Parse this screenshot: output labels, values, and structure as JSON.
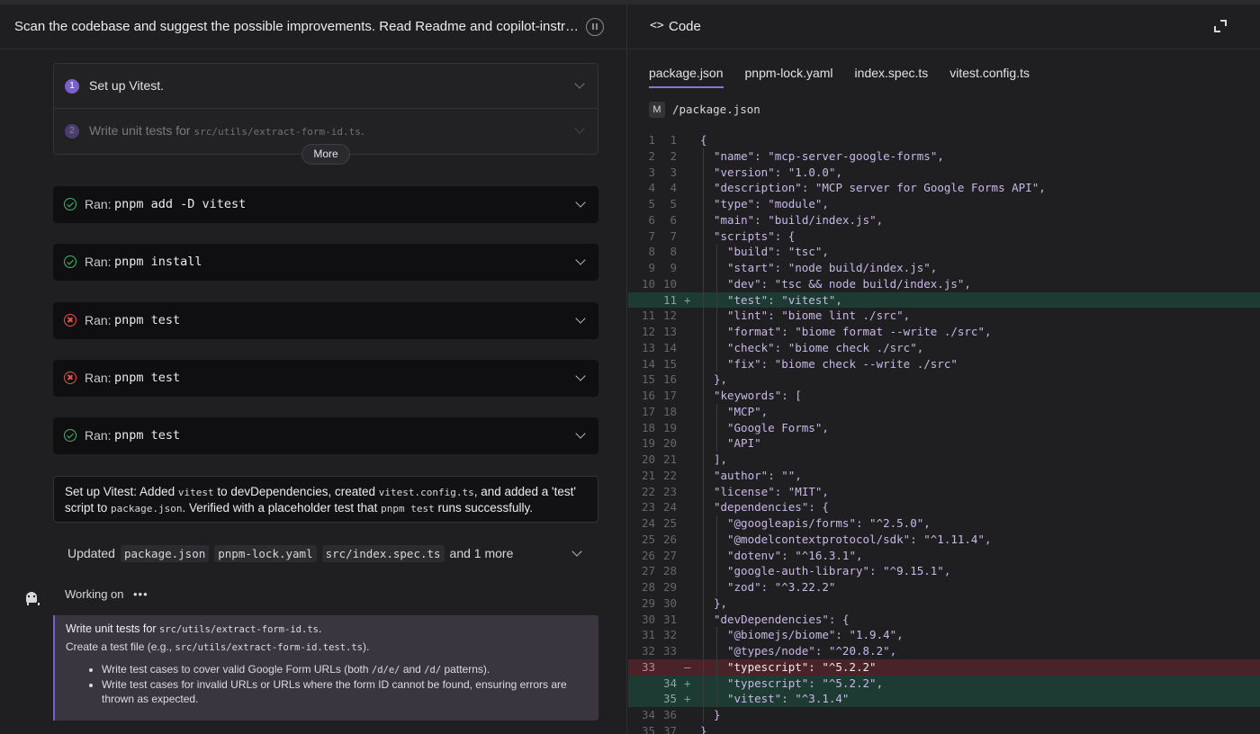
{
  "task": {
    "title": "Scan the codebase and suggest the possible improvements. Read Readme and copilot-instructions.md",
    "pause_icon": "pause-icon"
  },
  "plan": {
    "steps": [
      {
        "number": "1",
        "label": "Set up Vitest.",
        "code": ""
      },
      {
        "number": "2",
        "label": "Write unit tests for ",
        "code": "src/utils/extract-form-id.ts",
        "suffix": "."
      }
    ],
    "more_label": "More"
  },
  "runs": [
    {
      "status": "success",
      "label": "Ran:",
      "command": "pnpm add -D vitest"
    },
    {
      "status": "success",
      "label": "Ran:",
      "command": "pnpm install"
    },
    {
      "status": "error",
      "label": "Ran:",
      "command": "pnpm test"
    },
    {
      "status": "error",
      "label": "Ran:",
      "command": "pnpm test"
    },
    {
      "status": "success",
      "label": "Ran:",
      "command": "pnpm test"
    }
  ],
  "summary": {
    "t1": "Set up Vitest: Added ",
    "c1": "vitest",
    "t2": " to devDependencies, created ",
    "c2": "vitest.config.ts",
    "t3": ", and added a 'test' script to ",
    "c3": "package.json",
    "t4": ". Verified with a placeholder test that ",
    "c4": "pnpm test",
    "t5": " runs successfully."
  },
  "updated": {
    "label": "Updated",
    "files": [
      "package.json",
      "pnpm-lock.yaml",
      "src/index.spec.ts"
    ],
    "more": "and 1 more"
  },
  "working": {
    "label": "Working on",
    "dots": "•••",
    "title_text": "Write unit tests for ",
    "title_code": "src/utils/extract-form-id.ts",
    "title_suffix": ".",
    "desc_text": "Create a test file (e.g., ",
    "desc_code": "src/utils/extract-form-id.test.ts",
    "desc_suffix": ").",
    "b1_a": "Write test cases to cover valid Google Form URLs (both ",
    "b1_c1": "/d/e/",
    "b1_b": " and ",
    "b1_c2": "/d/",
    "b1_c": " patterns).",
    "b2": "Write test cases for invalid URLs or URLs where the form ID cannot be found, ensuring errors are thrown as expected."
  },
  "code_panel": {
    "title": "Code",
    "icon": "code-brackets-icon",
    "tabs": [
      "package.json",
      "pnpm-lock.yaml",
      "index.spec.ts",
      "vitest.config.ts"
    ],
    "active_tab": 0,
    "file_badge": "M",
    "file_path": "/package.json",
    "diff_lines": [
      {
        "old": "1",
        "new": "1",
        "type": "ctx",
        "indent": 0,
        "text": "{"
      },
      {
        "old": "2",
        "new": "2",
        "type": "ctx",
        "indent": 1,
        "text": "\"name\": \"mcp-server-google-forms\","
      },
      {
        "old": "3",
        "new": "3",
        "type": "ctx",
        "indent": 1,
        "text": "\"version\": \"1.0.0\","
      },
      {
        "old": "4",
        "new": "4",
        "type": "ctx",
        "indent": 1,
        "text": "\"description\": \"MCP server for Google Forms API\","
      },
      {
        "old": "5",
        "new": "5",
        "type": "ctx",
        "indent": 1,
        "text": "\"type\": \"module\","
      },
      {
        "old": "6",
        "new": "6",
        "type": "ctx",
        "indent": 1,
        "text": "\"main\": \"build/index.js\","
      },
      {
        "old": "7",
        "new": "7",
        "type": "ctx",
        "indent": 1,
        "text": "\"scripts\": {"
      },
      {
        "old": "8",
        "new": "8",
        "type": "ctx",
        "indent": 2,
        "text": "\"build\": \"tsc\","
      },
      {
        "old": "9",
        "new": "9",
        "type": "ctx",
        "indent": 2,
        "text": "\"start\": \"node build/index.js\","
      },
      {
        "old": "10",
        "new": "10",
        "type": "ctx",
        "indent": 2,
        "text": "\"dev\": \"tsc && node build/index.js\","
      },
      {
        "old": "",
        "new": "11",
        "type": "add",
        "indent": 2,
        "text": "\"test\": \"vitest\","
      },
      {
        "old": "11",
        "new": "12",
        "type": "ctx",
        "indent": 2,
        "text": "\"lint\": \"biome lint ./src\","
      },
      {
        "old": "12",
        "new": "13",
        "type": "ctx",
        "indent": 2,
        "text": "\"format\": \"biome format --write ./src\","
      },
      {
        "old": "13",
        "new": "14",
        "type": "ctx",
        "indent": 2,
        "text": "\"check\": \"biome check ./src\","
      },
      {
        "old": "14",
        "new": "15",
        "type": "ctx",
        "indent": 2,
        "text": "\"fix\": \"biome check --write ./src\""
      },
      {
        "old": "15",
        "new": "16",
        "type": "ctx",
        "indent": 1,
        "text": "},"
      },
      {
        "old": "16",
        "new": "17",
        "type": "ctx",
        "indent": 1,
        "text": "\"keywords\": ["
      },
      {
        "old": "17",
        "new": "18",
        "type": "ctx",
        "indent": 2,
        "text": "\"MCP\","
      },
      {
        "old": "18",
        "new": "19",
        "type": "ctx",
        "indent": 2,
        "text": "\"Google Forms\","
      },
      {
        "old": "19",
        "new": "20",
        "type": "ctx",
        "indent": 2,
        "text": "\"API\""
      },
      {
        "old": "20",
        "new": "21",
        "type": "ctx",
        "indent": 1,
        "text": "],"
      },
      {
        "old": "21",
        "new": "22",
        "type": "ctx",
        "indent": 1,
        "text": "\"author\": \"\","
      },
      {
        "old": "22",
        "new": "23",
        "type": "ctx",
        "indent": 1,
        "text": "\"license\": \"MIT\","
      },
      {
        "old": "23",
        "new": "24",
        "type": "ctx",
        "indent": 1,
        "text": "\"dependencies\": {"
      },
      {
        "old": "24",
        "new": "25",
        "type": "ctx",
        "indent": 2,
        "text": "\"@googleapis/forms\": \"^2.5.0\","
      },
      {
        "old": "25",
        "new": "26",
        "type": "ctx",
        "indent": 2,
        "text": "\"@modelcontextprotocol/sdk\": \"^1.11.4\","
      },
      {
        "old": "26",
        "new": "27",
        "type": "ctx",
        "indent": 2,
        "text": "\"dotenv\": \"^16.3.1\","
      },
      {
        "old": "27",
        "new": "28",
        "type": "ctx",
        "indent": 2,
        "text": "\"google-auth-library\": \"^9.15.1\","
      },
      {
        "old": "28",
        "new": "29",
        "type": "ctx",
        "indent": 2,
        "text": "\"zod\": \"^3.22.2\""
      },
      {
        "old": "29",
        "new": "30",
        "type": "ctx",
        "indent": 1,
        "text": "},"
      },
      {
        "old": "30",
        "new": "31",
        "type": "ctx",
        "indent": 1,
        "text": "\"devDependencies\": {"
      },
      {
        "old": "31",
        "new": "32",
        "type": "ctx",
        "indent": 2,
        "text": "\"@biomejs/biome\": \"1.9.4\","
      },
      {
        "old": "32",
        "new": "33",
        "type": "ctx",
        "indent": 2,
        "text": "\"@types/node\": \"^20.8.2\","
      },
      {
        "old": "33",
        "new": "",
        "type": "del",
        "indent": 2,
        "text": "\"typescript\": \"^5.2.2\""
      },
      {
        "old": "",
        "new": "34",
        "type": "add",
        "indent": 2,
        "text": "\"typescript\": \"^5.2.2\","
      },
      {
        "old": "",
        "new": "35",
        "type": "add",
        "indent": 2,
        "text": "\"vitest\": \"^3.1.4\""
      },
      {
        "old": "34",
        "new": "36",
        "type": "ctx",
        "indent": 1,
        "text": "}"
      },
      {
        "old": "35",
        "new": "37",
        "type": "ctx",
        "indent": 0,
        "text": "}"
      }
    ]
  },
  "colors": {
    "added_bg": "#1d3a33",
    "removed_bg": "#4a2229",
    "accent": "#7a61c9",
    "success": "#3fb96a",
    "error": "#e5534b"
  }
}
